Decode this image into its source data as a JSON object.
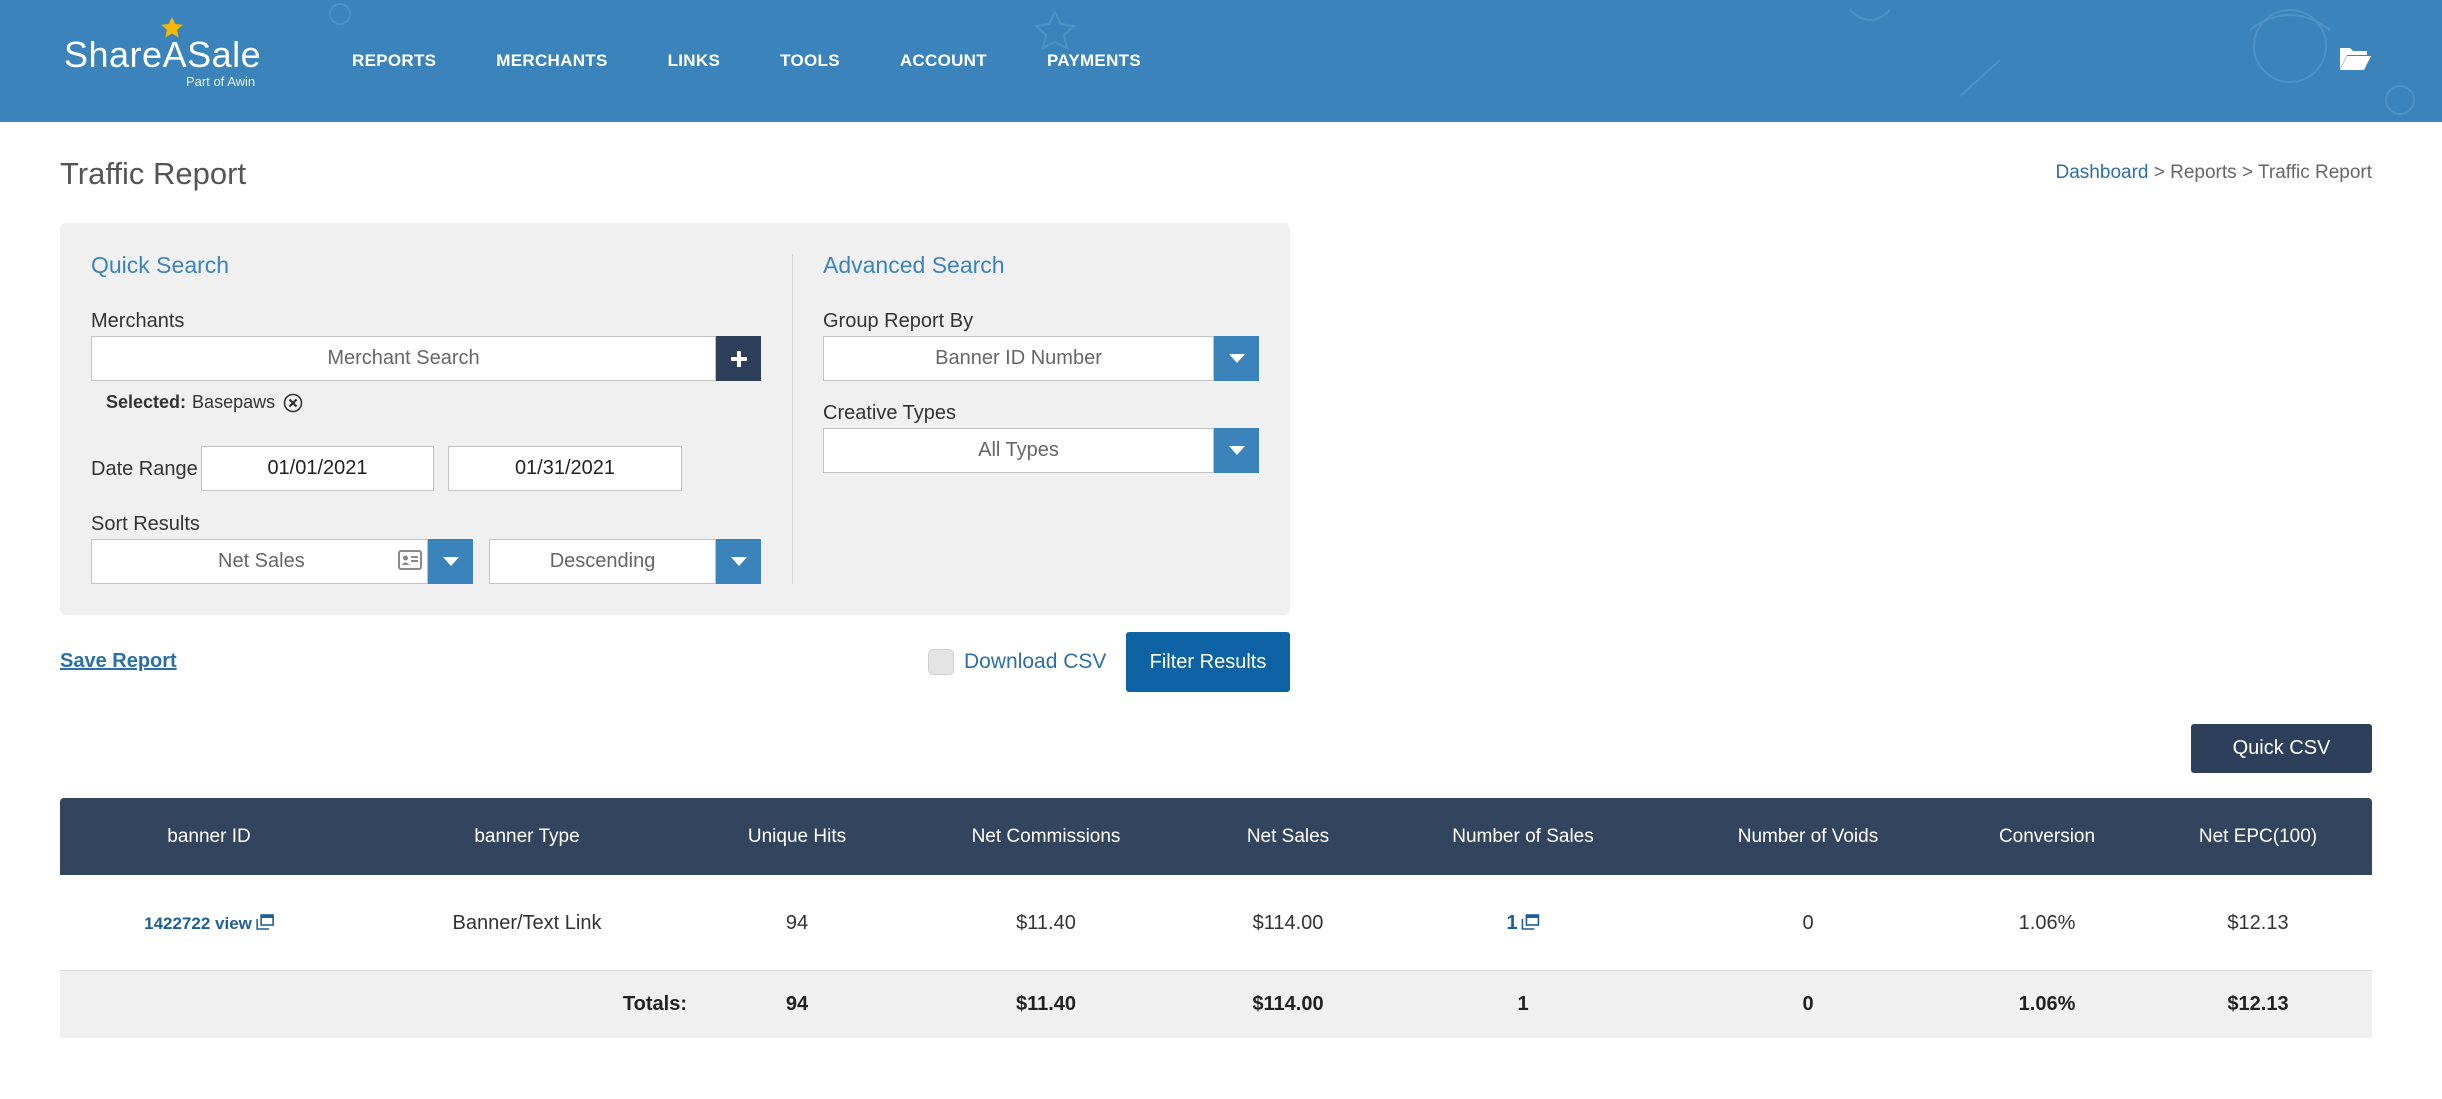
{
  "header": {
    "logo_text": "ShareASale",
    "logo_sub": "Part of Awin",
    "nav": [
      "REPORTS",
      "MERCHANTS",
      "LINKS",
      "TOOLS",
      "ACCOUNT",
      "PAYMENTS"
    ],
    "brand_color": "#3b84bb"
  },
  "page": {
    "title": "Traffic Report",
    "breadcrumb": {
      "link": "Dashboard",
      "rest": " > Reports > Traffic Report"
    }
  },
  "quick_search": {
    "title": "Quick Search",
    "merchants_label": "Merchants",
    "merchant_placeholder": "Merchant Search",
    "selected_label": "Selected:",
    "selected_value": "Basepaws",
    "date_range_label": "Date Range",
    "date_start": "01/01/2021",
    "date_end": "01/31/2021",
    "sort_label": "Sort Results",
    "sort_field": "Net Sales",
    "sort_order": "Descending"
  },
  "advanced_search": {
    "title": "Advanced Search",
    "group_label": "Group Report By",
    "group_value": "Banner ID Number",
    "creative_label": "Creative Types",
    "creative_value": "All Types"
  },
  "actions": {
    "save_report": "Save Report",
    "download_csv": "Download CSV",
    "filter_results": "Filter Results",
    "quick_csv": "Quick CSV"
  },
  "table": {
    "headers": [
      "banner ID",
      "banner Type",
      "Unique Hits",
      "Net Commissions",
      "Net Sales",
      "Number of Sales",
      "Number of Voids",
      "Conversion",
      "Net EPC(100)"
    ],
    "rows": [
      {
        "banner_id": "1422722 view",
        "banner_type": "Banner/Text Link",
        "unique_hits": "94",
        "net_commissions": "$11.40",
        "net_sales": "$114.00",
        "number_of_sales": "1",
        "number_of_voids": "0",
        "conversion": "1.06%",
        "net_epc": "$12.13"
      }
    ],
    "totals": {
      "label": "Totals:",
      "unique_hits": "94",
      "net_commissions": "$11.40",
      "net_sales": "$114.00",
      "number_of_sales": "1",
      "number_of_voids": "0",
      "conversion": "1.06%",
      "net_epc": "$12.13"
    }
  }
}
